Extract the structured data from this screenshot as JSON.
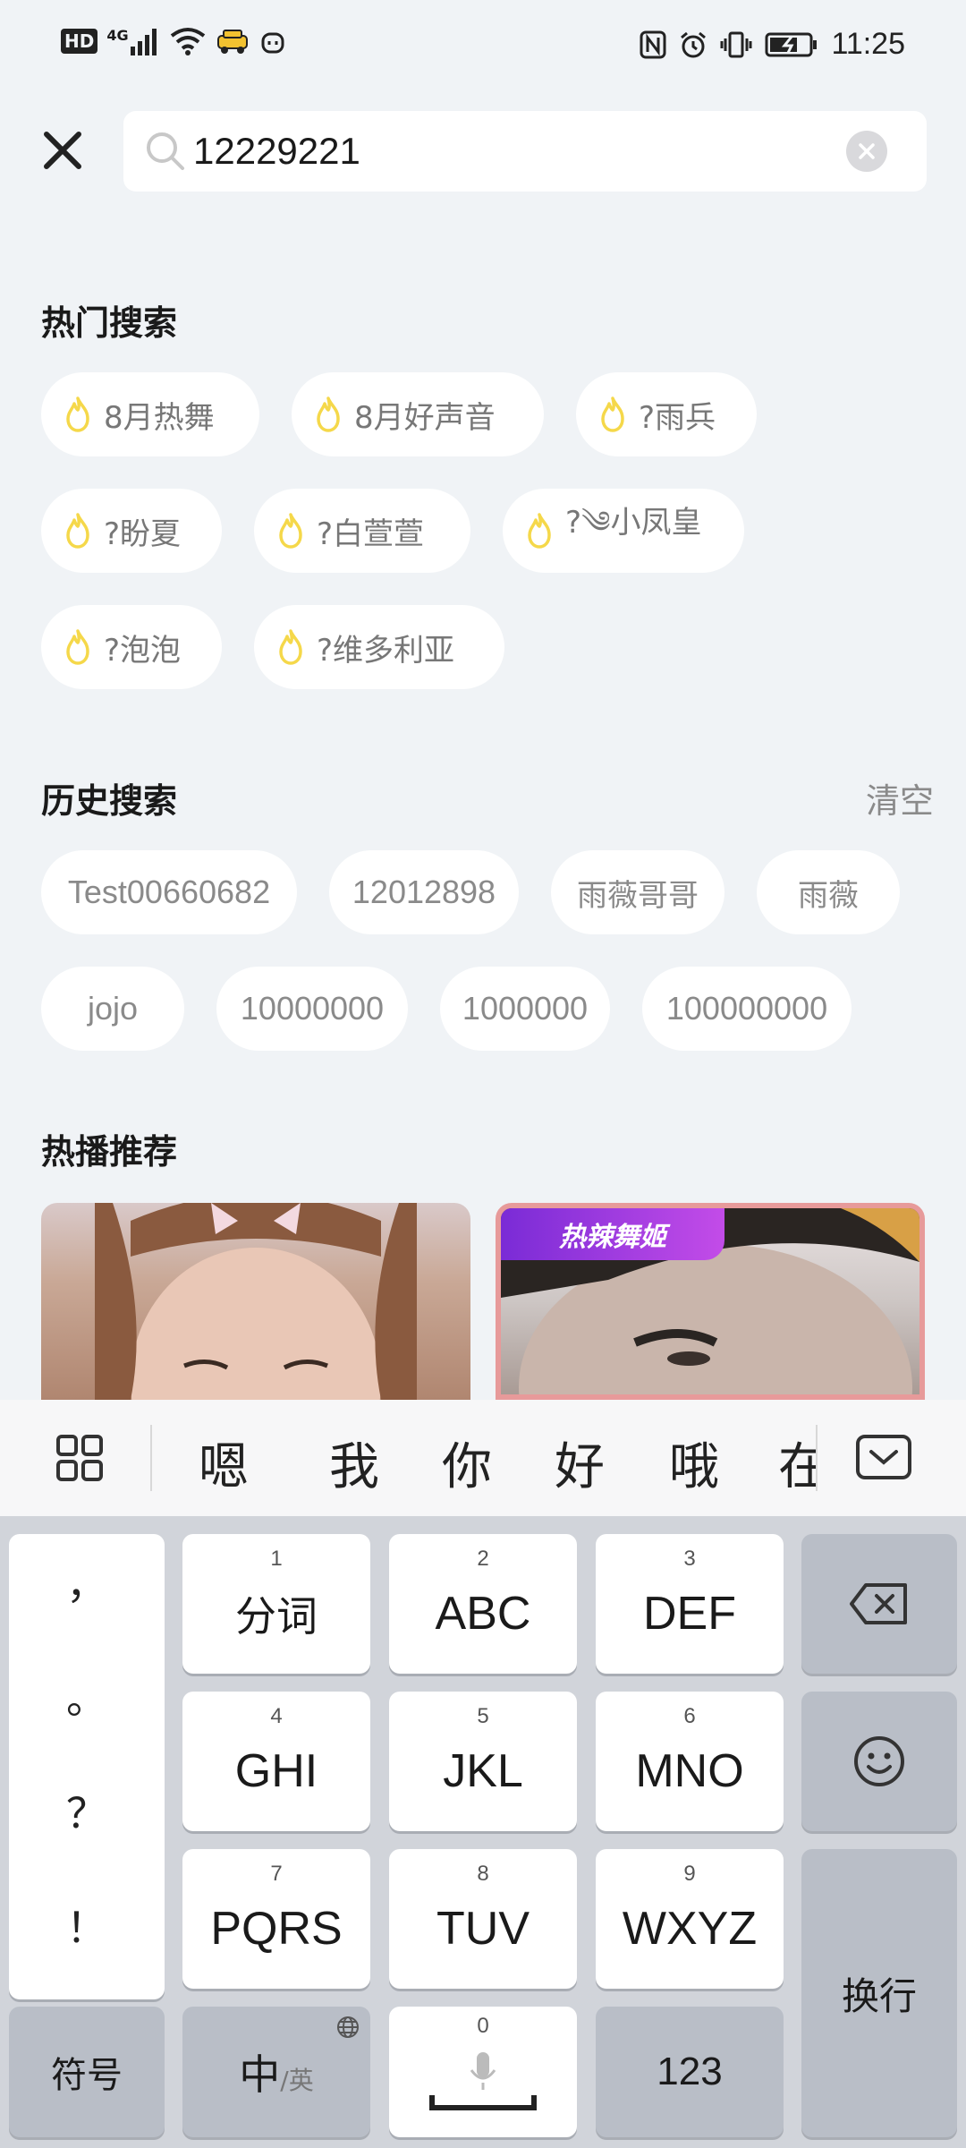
{
  "status_bar": {
    "network": "HD",
    "signal": "4G",
    "time": "11:25"
  },
  "search": {
    "value": "12229221"
  },
  "hot_search": {
    "title": "热门搜索",
    "items": [
      "8月热舞",
      "8月好声音",
      "?雨兵",
      "?盼夏",
      "?白萱萱",
      "?༄小凤皇",
      "?泡泡",
      "?维多利亚"
    ]
  },
  "history": {
    "title": "历史搜索",
    "clear_label": "清空",
    "items": [
      "Test00660682",
      "12012898",
      "雨薇哥哥",
      "雨薇",
      "jojo",
      "10000000",
      "1000000",
      "100000000"
    ]
  },
  "recommend": {
    "title": "热播推荐",
    "cards": [
      {
        "badge": ""
      },
      {
        "badge": "热辣舞姬"
      }
    ]
  },
  "keyboard": {
    "candidates": [
      "嗯",
      "我",
      "你",
      "好",
      "哦",
      "在"
    ],
    "punctuation": [
      "，",
      "。",
      "？",
      "！"
    ],
    "keys": [
      {
        "num": "1",
        "label": "分词"
      },
      {
        "num": "2",
        "label": "ABC"
      },
      {
        "num": "3",
        "label": "DEF"
      },
      {
        "num": "4",
        "label": "GHI"
      },
      {
        "num": "5",
        "label": "JKL"
      },
      {
        "num": "6",
        "label": "MNO"
      },
      {
        "num": "7",
        "label": "PQRS"
      },
      {
        "num": "8",
        "label": "TUV"
      },
      {
        "num": "9",
        "label": "WXYZ"
      }
    ],
    "symbol_label": "符号",
    "lang_main": "中",
    "lang_alt": "/英",
    "space_num": "0",
    "num_label": "123",
    "enter_label": "换行"
  },
  "colors": {
    "background": "#f0f3f6",
    "flame": "#f5d84a",
    "badge": "#a33ee0"
  }
}
